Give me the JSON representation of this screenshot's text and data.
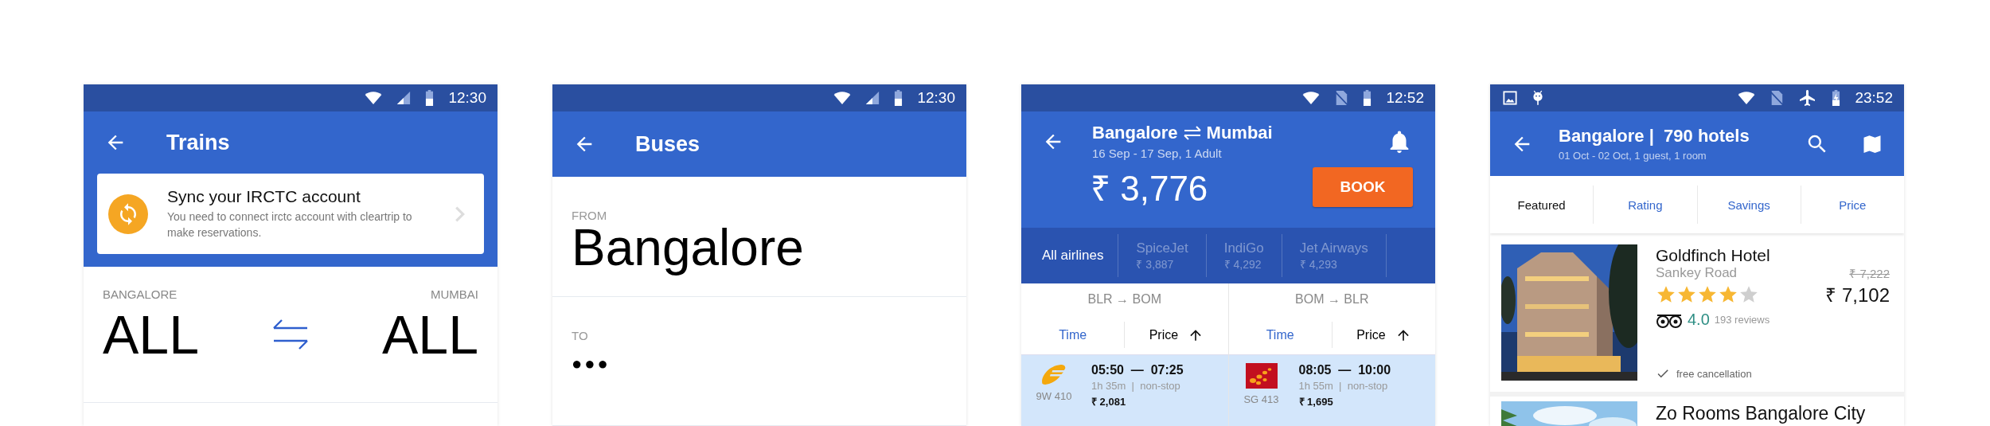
{
  "screens": [
    {
      "kind": "trains",
      "status_time": "12:30",
      "title": "Trains",
      "banner": {
        "title": "Sync your IRCTC account",
        "text": "You need to connect irctc account with cleartrip to make reservations."
      },
      "from": {
        "label": "BANGALORE",
        "value": "ALL"
      },
      "to": {
        "label": "MUMBAI",
        "value": "ALL"
      }
    },
    {
      "kind": "buses",
      "status_time": "12:30",
      "title": "Buses",
      "from": {
        "label": "FROM",
        "value": "Bangalore"
      },
      "to": {
        "label": "TO",
        "value": "●●●"
      }
    },
    {
      "kind": "flights",
      "status_time": "12:52",
      "origin": "Bangalore",
      "destination": "Mumbai",
      "subtitle": "16 Sep - 17 Sep, 1 Adult",
      "price": "₹ 3,776",
      "book": "BOOK",
      "airlines": [
        {
          "name": "All airlines",
          "selected": true
        },
        {
          "name": "SpiceJet",
          "price": "₹ 3,887",
          "selected": false
        },
        {
          "name": "IndiGo",
          "price": "₹ 4,292",
          "selected": false
        },
        {
          "name": "Jet Airways",
          "price": "₹ 4,293",
          "selected": false
        }
      ],
      "legs": [
        {
          "route": "BLR → BOM",
          "sorts": [
            {
              "label": "Time",
              "selected": false
            },
            {
              "label": "Price",
              "selected": true
            }
          ],
          "flight": {
            "kind": "swoosh",
            "code": "9W 410",
            "times": "05:50  —  07:25",
            "duration": "1h 35m  |  non-stop",
            "price": "₹ 2,081"
          }
        },
        {
          "route": "BOM → BLR",
          "sorts": [
            {
              "label": "Time",
              "selected": false
            },
            {
              "label": "Price",
              "selected": true
            }
          ],
          "flight": {
            "kind": "dots",
            "code": "SG 413",
            "times": "08:05  —  10:00",
            "duration": "1h 55m  |  non-stop",
            "price": "₹ 1,695"
          }
        }
      ]
    },
    {
      "kind": "hotels",
      "status_time": "23:52",
      "title": "Bangalore |  790 hotels",
      "subtitle": "01 Oct - 02 Oct, 1 guest, 1 room",
      "tabs": [
        {
          "label": "Featured",
          "selected": true
        },
        {
          "label": "Rating",
          "selected": false
        },
        {
          "label": "Savings",
          "selected": false
        },
        {
          "label": "Price",
          "selected": false
        }
      ],
      "hotels": [
        {
          "name": "Goldfinch Hotel",
          "area": "Sankey Road",
          "old_price": "₹ 7,222",
          "price": "₹ 7,102",
          "stars": 4,
          "rating": "4.0",
          "reviews": "193 reviews",
          "perk": "free cancellation"
        },
        {
          "name": "Zo Rooms Bangalore City"
        }
      ]
    }
  ]
}
